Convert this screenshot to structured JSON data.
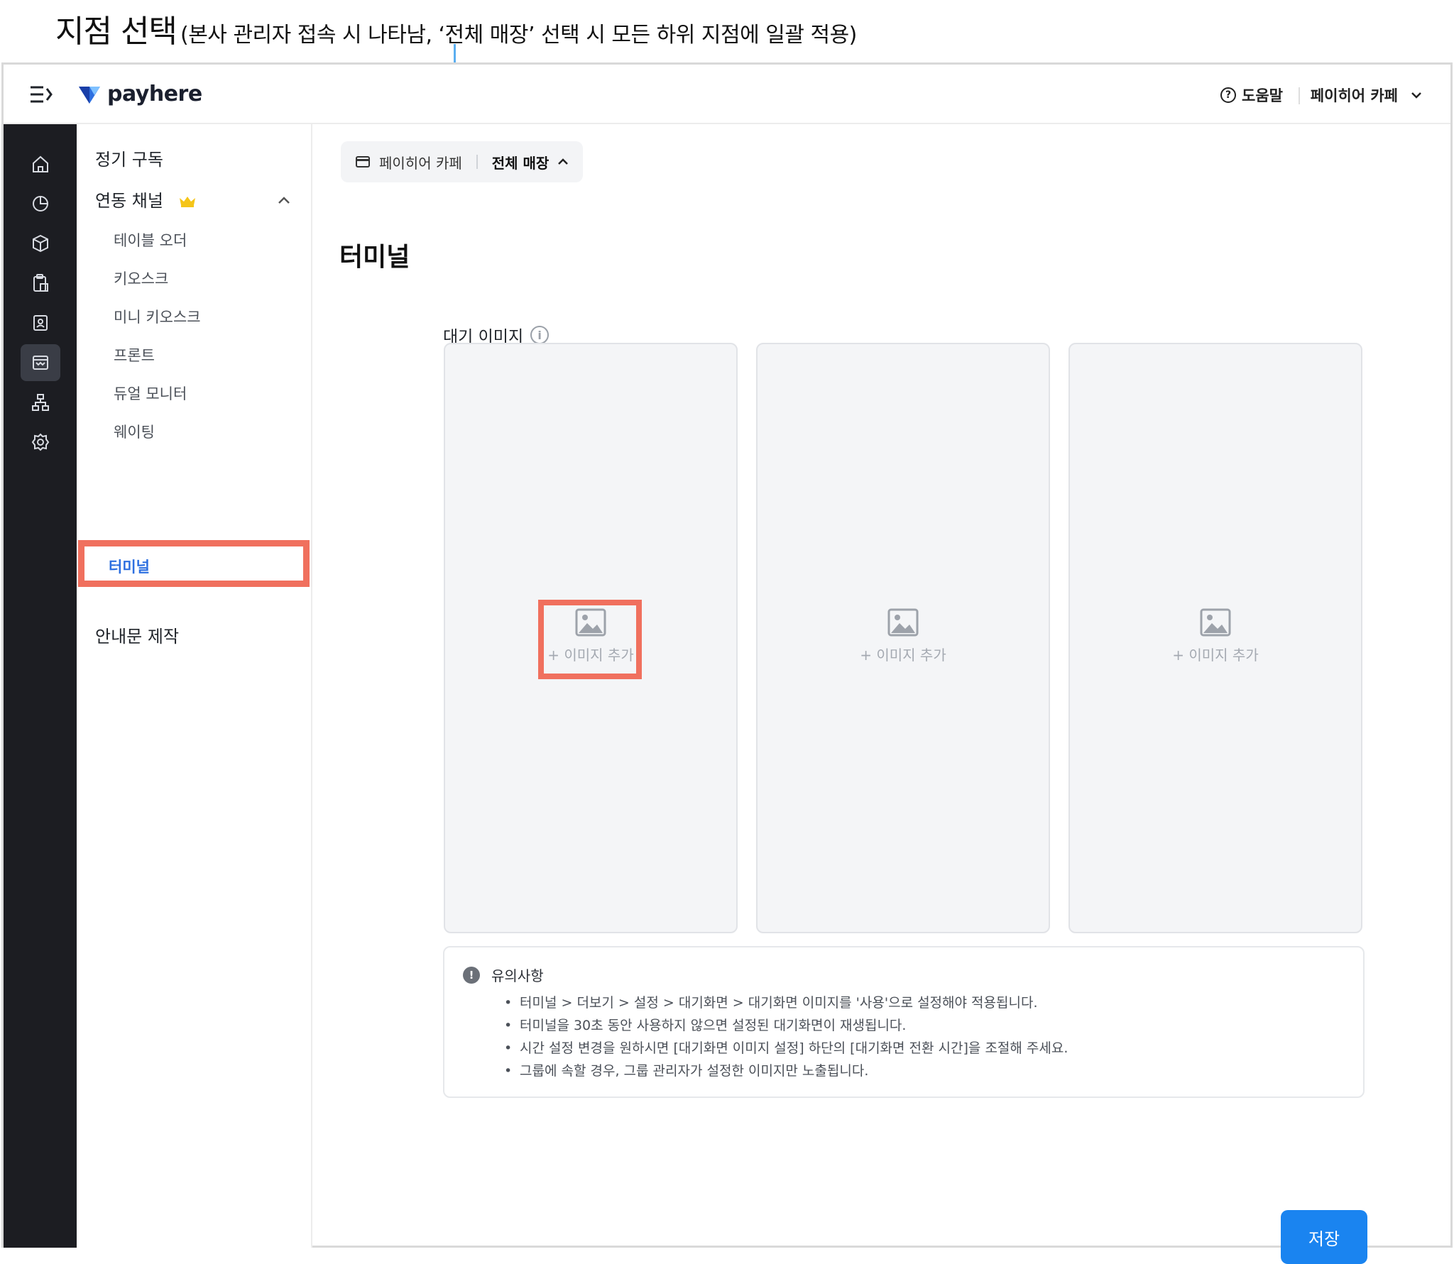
{
  "annotation": {
    "title": "지점 선택",
    "note": "(본사 관리자 접속 시 나타남, ‘전체 매장’ 선택 시 모든 하위 지점에 일괄 적용)"
  },
  "header": {
    "logo_text": "payhere",
    "help_label": "도움말",
    "account_label": "페이히어 카페"
  },
  "submenu": {
    "subscription": "정기 구독",
    "linked_channels": "연동 채널",
    "items": [
      "테이블 오더",
      "키오스크",
      "미니 키오스크",
      "프론트",
      "듀얼 모니터",
      "웨이팅"
    ],
    "terminal": "터미널",
    "notice_maker": "안내문 제작"
  },
  "store_selector": {
    "store_name": "페이히어 카페",
    "scope": "전체 매장"
  },
  "main": {
    "title": "터미널",
    "standby_label": "대기 이미지",
    "add_image_label": "+ 이미지 추가",
    "notice_title": "유의사항",
    "notices": [
      "터미널 > 더보기 > 설정 > 대기화면 > 대기화면 이미지를 '사용'으로 설정해야 적용됩니다.",
      "터미널을 30초 동안 사용하지 않으면 설정된 대기화면이 재생됩니다.",
      "시간 설정 변경을 원하시면 [대기화면 이미지 설정] 하단의 [대기화면 전환 시간]을 조절해 주세요.",
      "그룹에 속할 경우, 그룹 관리자가 설정한 이미지만 노출됩니다."
    ],
    "save_label": "저장"
  },
  "colors": {
    "accent": "#1a84f0",
    "highlight": "#f0705e",
    "rail": "#1c1d22",
    "callout": "#5aaef0",
    "active_link": "#2d6fe0"
  },
  "icons": {
    "rail": [
      "home-icon",
      "chart-icon",
      "box-icon",
      "clipboard-icon",
      "contact-icon",
      "store-icon",
      "sitemap-icon",
      "gear-icon"
    ]
  }
}
